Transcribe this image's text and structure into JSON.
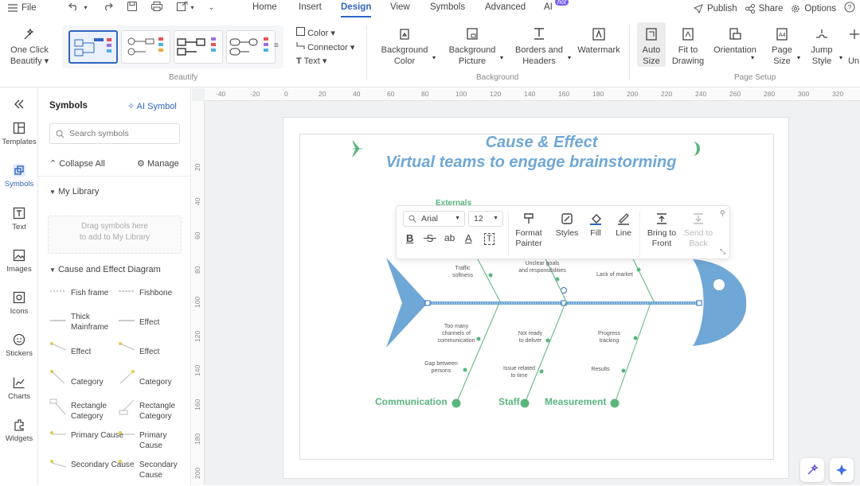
{
  "menubar": {
    "file": "File",
    "tabs": [
      "Home",
      "Insert",
      "Design",
      "View",
      "Symbols",
      "Advanced",
      "AI"
    ],
    "active_tab": "Design",
    "ai_badge": "hot",
    "publish": "Publish",
    "share": "Share",
    "options": "Options"
  },
  "ribbon": {
    "one_click": "One Click",
    "beautify": "Beautify",
    "group_beautify": "Beautify",
    "color": "Color",
    "connector": "Connector",
    "text": "Text",
    "bg_color_1": "Background",
    "bg_color_2": "Color",
    "bg_picture_1": "Background",
    "bg_picture_2": "Picture",
    "borders_1": "Borders and",
    "borders_2": "Headers",
    "watermark": "Watermark",
    "group_background": "Background",
    "auto_1": "Auto",
    "auto_2": "Size",
    "fit_1": "Fit to",
    "fit_2": "Drawing",
    "orientation": "Orientation",
    "page_1": "Page",
    "page_2": "Size",
    "jump_1": "Jump",
    "jump_2": "Style",
    "un": "Un",
    "group_page_setup": "Page Setup"
  },
  "rail": [
    "Templates",
    "Symbols",
    "Text",
    "Images",
    "Icons",
    "Stickers",
    "Charts",
    "Widgets"
  ],
  "panel": {
    "title": "Symbols",
    "ai_symbol": "AI Symbol",
    "search_placeholder": "Search symbols",
    "collapse_all": "Collapse All",
    "manage": "Manage",
    "my_library": "My Library",
    "drop_1": "Drag symbols here",
    "drop_2": "to add to My Library",
    "cause_effect": "Cause and Effect Diagram",
    "symbols": [
      [
        "Fish frame",
        "Fishbone"
      ],
      [
        "Thick Mainframe",
        "Effect"
      ],
      [
        "Effect",
        "Effect"
      ],
      [
        "Category",
        "Category"
      ],
      [
        "Rectangle Category",
        "Rectangle Category"
      ],
      [
        "Primary Cause",
        "Primary Cause"
      ],
      [
        "Secondary Cause",
        "Secondary Cause"
      ]
    ]
  },
  "ruler": {
    "h": [
      "-40",
      "-20",
      "0",
      "20",
      "40",
      "60",
      "80",
      "100",
      "120",
      "140",
      "160",
      "180",
      "200",
      "220",
      "240",
      "260",
      "280",
      "300",
      "320"
    ],
    "v": [
      "20",
      "40",
      "60",
      "80",
      "100",
      "120",
      "140",
      "160",
      "180",
      "200"
    ]
  },
  "diagram": {
    "title_1": "Cause & Effect",
    "title_2": "Virtual teams to engage brainstorming",
    "title_color": "#6fa7d6",
    "fish_color": "#6fa7d6",
    "accent_green": "#5ab57e",
    "hidden_label": "Externals",
    "cause_labels": {
      "c1": "Traffic softness",
      "c2": "Unclear goals and responsibilities",
      "c3": "Lack of market",
      "c4": "Too many channels of communication",
      "c5": "Not ready to deliver",
      "c6": "Progress tracking",
      "c7": "Gap between persons",
      "c8": "Issue related to time",
      "c9": "Results"
    },
    "categories": [
      "Communication",
      "Staff",
      "Measurement"
    ]
  },
  "float_toolbar": {
    "font": "Arial",
    "size": "12",
    "format_1": "Format",
    "format_2": "Painter",
    "styles": "Styles",
    "fill": "Fill",
    "line": "Line",
    "front_1": "Bring to",
    "front_2": "Front",
    "back_1": "Send to",
    "back_2": "Back"
  }
}
